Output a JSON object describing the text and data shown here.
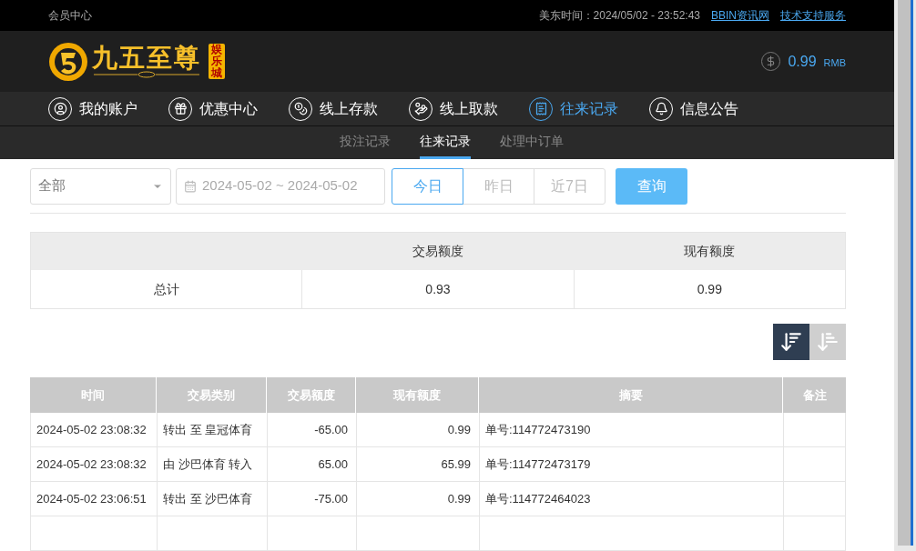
{
  "top_bar": {
    "title": "会员中心",
    "clock": "美东时间：2024/05/02 - 23:52:43",
    "links": [
      "BBIN资讯网",
      "技术支持服务"
    ]
  },
  "logo": {
    "name": "九五至尊",
    "badge": "娱乐城"
  },
  "balance": {
    "amount": "0.99",
    "currency": "RMB"
  },
  "nav": [
    {
      "kind": "account",
      "label": "我的账户",
      "selected": false
    },
    {
      "kind": "gift",
      "label": "优惠中心",
      "selected": false
    },
    {
      "kind": "deposit",
      "label": "线上存款",
      "selected": false
    },
    {
      "kind": "withdraw",
      "label": "线上取款",
      "selected": false
    },
    {
      "kind": "records",
      "label": "往来记录",
      "selected": true
    },
    {
      "kind": "notice",
      "label": "信息公告",
      "selected": false
    }
  ],
  "sub_tabs": [
    {
      "label": "投注记录",
      "selected": false
    },
    {
      "label": "往来记录",
      "selected": true
    },
    {
      "label": "处理中订单",
      "selected": false
    }
  ],
  "filters": {
    "category": "全部",
    "date_range": "2024-05-02 ~ 2024-05-02",
    "ranges": [
      {
        "label": "今日",
        "selected": true
      },
      {
        "label": "昨日",
        "selected": false
      },
      {
        "label": "近7日",
        "selected": false
      }
    ],
    "query_button": "查询"
  },
  "summary": {
    "columns": [
      "交易额度",
      "现有额度"
    ],
    "row": {
      "label": "总计",
      "values": [
        "0.93",
        "0.99"
      ]
    }
  },
  "sort_buttons": [
    {
      "kind": "desc",
      "selected": true
    },
    {
      "kind": "asc",
      "selected": false
    }
  ],
  "table": {
    "columns": [
      "时间",
      "交易类别",
      "交易额度",
      "现有额度",
      "摘要",
      "备注"
    ],
    "rows": [
      [
        "2024-05-02 23:08:32",
        "转出 至 皇冠体育",
        "-65.00",
        "0.99",
        "单号:114772473190",
        ""
      ],
      [
        "2024-05-02 23:08:32",
        "由 沙巴体育 转入",
        "65.00",
        "65.99",
        "单号:114772473179",
        ""
      ],
      [
        "2024-05-02 23:06:51",
        "转出 至 沙巴体育",
        "-75.00",
        "0.99",
        "单号:114772464023",
        ""
      ]
    ]
  }
}
